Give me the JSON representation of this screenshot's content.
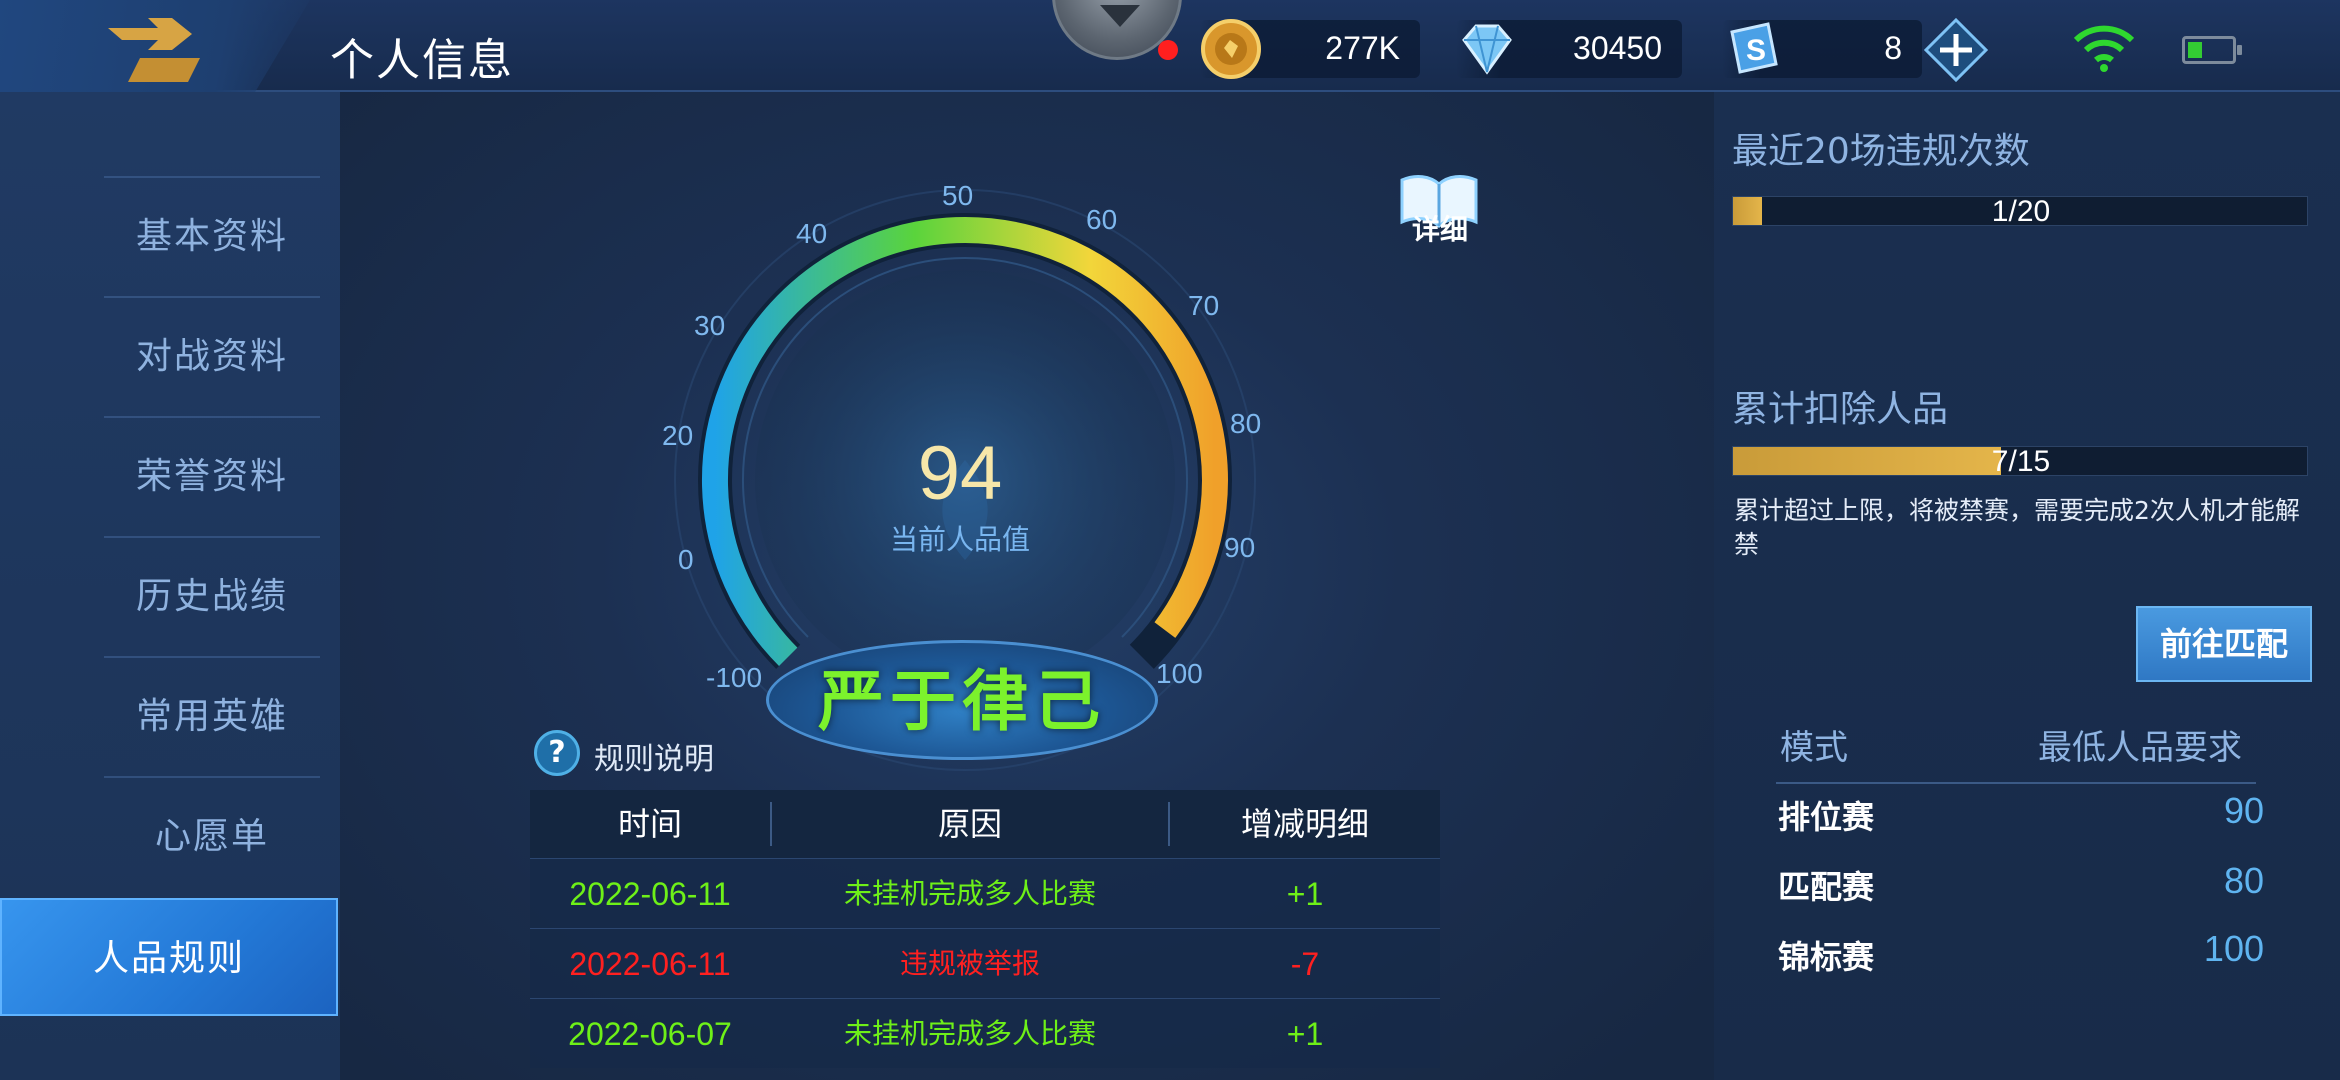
{
  "header": {
    "title": "个人信息",
    "currencies": [
      {
        "name": "gold",
        "icon": "gold-coin-icon",
        "value": "277K"
      },
      {
        "name": "diamond",
        "icon": "diamond-icon",
        "value": "30450"
      },
      {
        "name": "voucher",
        "icon": "voucher-icon",
        "value": "8"
      }
    ]
  },
  "sidebar": {
    "items": [
      {
        "label": "基本资料",
        "active": false
      },
      {
        "label": "对战资料",
        "active": false
      },
      {
        "label": "荣誉资料",
        "active": false
      },
      {
        "label": "历史战绩",
        "active": false
      },
      {
        "label": "常用英雄",
        "active": false
      },
      {
        "label": "心愿单",
        "active": false
      },
      {
        "label": "人品规则",
        "active": true
      }
    ]
  },
  "gauge": {
    "score": "94",
    "score_label": "当前人品值",
    "rating": "严于律己",
    "ticks": [
      "-100",
      "0",
      "20",
      "30",
      "40",
      "50",
      "60",
      "70",
      "80",
      "90",
      "100"
    ],
    "colors": {
      "low": "#1fa3e8",
      "mid": "#5ad43c",
      "high": "#f2d63a",
      "top": "#f0a02a"
    }
  },
  "detail": {
    "label": "详细"
  },
  "rules": {
    "label": "规则说明"
  },
  "history": {
    "headers": [
      "时间",
      "原因",
      "增减明细"
    ],
    "rows": [
      {
        "date": "2022-06-11",
        "reason": "未挂机完成多人比赛",
        "delta": "+1",
        "type": "pos"
      },
      {
        "date": "2022-06-11",
        "reason": "违规被举报",
        "delta": "-7",
        "type": "neg"
      },
      {
        "date": "2022-06-07",
        "reason": "未挂机完成多人比赛",
        "delta": "+1",
        "type": "pos"
      }
    ]
  },
  "violations": {
    "title": "最近20场违规次数",
    "text": "1/20",
    "fraction": 0.05
  },
  "deductions": {
    "title": "累计扣除人品",
    "text": "7/15",
    "fraction": 0.4667,
    "note": "累计超过上限，将被禁赛，需要完成2次人机才能解禁"
  },
  "go_button": {
    "label": "前往匹配"
  },
  "modes": {
    "headers": [
      "模式",
      "最低人品要求"
    ],
    "rows": [
      {
        "name": "排位赛",
        "value": "90"
      },
      {
        "name": "匹配赛",
        "value": "80"
      },
      {
        "name": "锦标赛",
        "value": "100"
      }
    ]
  }
}
